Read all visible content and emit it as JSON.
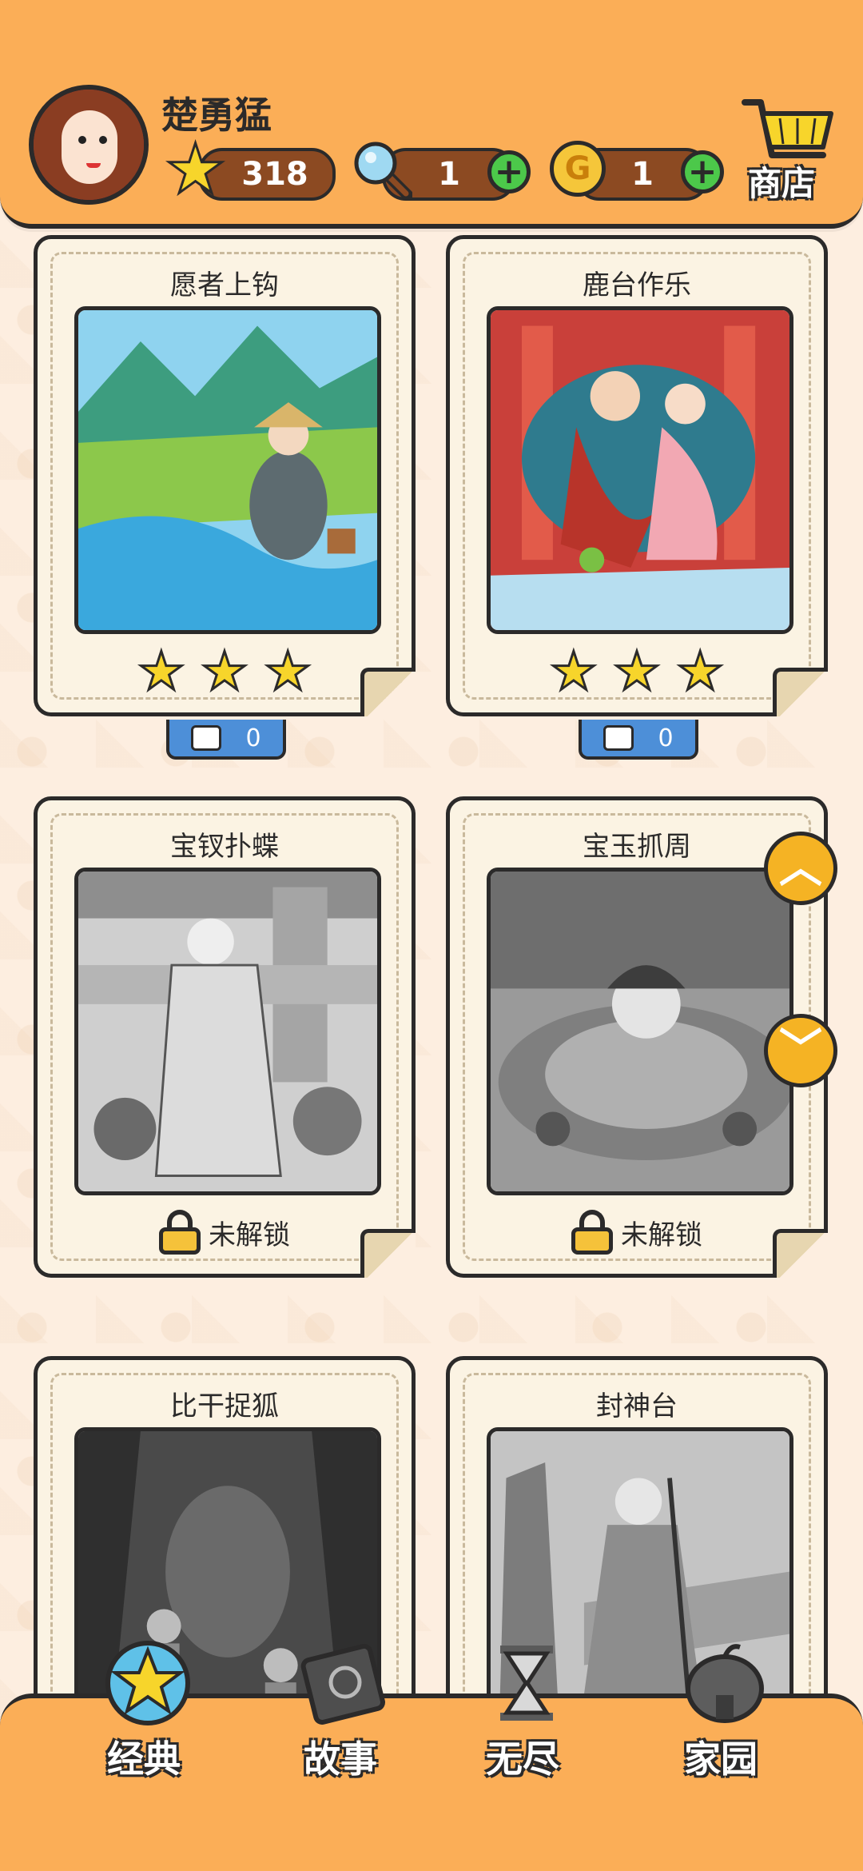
{
  "header": {
    "username": "楚勇猛",
    "stars_count": "318",
    "magnifier_count": "1",
    "coin_count": "1",
    "coin_symbol": "G",
    "shop_label": "商店"
  },
  "levels": [
    {
      "title": "愿者上钩",
      "state": "completed",
      "stars": "★★★",
      "comments": "0"
    },
    {
      "title": "鹿台作乐",
      "state": "completed",
      "stars": "★★★",
      "comments": "0"
    },
    {
      "title": "宝钗扑蝶",
      "state": "locked",
      "lock_text": "未解锁"
    },
    {
      "title": "宝玉抓周",
      "state": "locked",
      "lock_text": "未解锁"
    },
    {
      "title": "比干捉狐",
      "state": "locked"
    },
    {
      "title": "封神台",
      "state": "locked"
    }
  ],
  "scroll": {
    "up": "︿",
    "down": "﹀"
  },
  "nav": [
    {
      "label": "经典",
      "icon": "star-medal-icon"
    },
    {
      "label": "故事",
      "icon": "book-icon"
    },
    {
      "label": "无尽",
      "icon": "hourglass-icon"
    },
    {
      "label": "家园",
      "icon": "pumpkin-house-icon"
    }
  ],
  "colors": {
    "header_bg": "#fbae57",
    "page_bg": "#fdeee0",
    "card_bg": "#fbf3e3",
    "star": "#f7d52b",
    "badge": "#4d8fd8",
    "plus": "#4cc84a"
  }
}
